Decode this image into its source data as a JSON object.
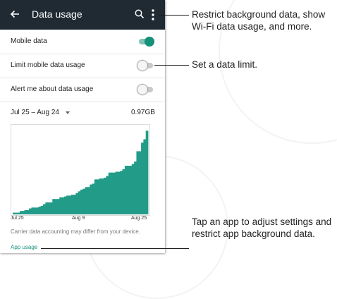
{
  "appbar": {
    "title": "Data usage",
    "back_icon": "arrow-back-icon",
    "search_icon": "search-icon",
    "more_icon": "more-vert-icon",
    "color": "#1f2a33"
  },
  "settings": [
    {
      "label": "Mobile data",
      "on": true
    },
    {
      "label": "Limit mobile data usage",
      "on": false
    },
    {
      "label": "Alert me about data usage",
      "on": false
    }
  ],
  "cycle": {
    "range": "Jul 25 – Aug 24",
    "total": "0.97GB"
  },
  "chart_data": {
    "type": "area",
    "x_ticks": [
      "Jul 25",
      "Aug 9",
      "Aug 25"
    ],
    "fill": "#229c88",
    "values": [
      0.02,
      0.02,
      0.02,
      0.04,
      0.04,
      0.05,
      0.05,
      0.07,
      0.08,
      0.08,
      0.08,
      0.09,
      0.1,
      0.12,
      0.14,
      0.14,
      0.14,
      0.18,
      0.18,
      0.18,
      0.2,
      0.2,
      0.21,
      0.22,
      0.22,
      0.23,
      0.23,
      0.25,
      0.27,
      0.29,
      0.3,
      0.32,
      0.32,
      0.35,
      0.36,
      0.41,
      0.41,
      0.42,
      0.42,
      0.43,
      0.45,
      0.49,
      0.49,
      0.49,
      0.5,
      0.5,
      0.51,
      0.53,
      0.57,
      0.57,
      0.57,
      0.59,
      0.62,
      0.74,
      0.74,
      0.84,
      0.88,
      0.98
    ]
  },
  "footer": {
    "note": "Carrier data accounting may differ from your device.",
    "app_usage": "App usage"
  },
  "callouts": {
    "menu": "Restrict background data, show Wi-Fi data usage, and more.",
    "limit": "Set a data limit.",
    "apps": "Tap an app to  adjust settings and restrict app background data."
  },
  "colors": {
    "accent": "#15907a"
  }
}
